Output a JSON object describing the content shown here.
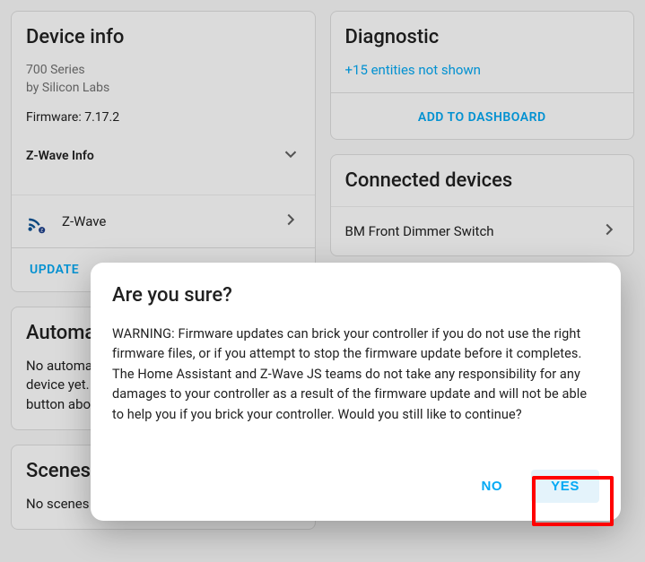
{
  "deviceInfo": {
    "title": "Device info",
    "series": "700 Series",
    "manufacturer": "by Silicon Labs",
    "firmwareLabel": "Firmware: 7.17.2",
    "zwaveInfoLabel": "Z-Wave Info",
    "zwaveLinkLabel": "Z-Wave",
    "updateLabel": "UPDATE"
  },
  "automations": {
    "title": "Automations",
    "body": "No automations have been added using this device yet. You can add one using the Create button above."
  },
  "scenes": {
    "title": "Scenes",
    "body": "No scenes have been added using this device"
  },
  "diagnostic": {
    "title": "Diagnostic",
    "entitiesNotShown": "+15 entities not shown",
    "addToDashboard": "ADD TO DASHBOARD"
  },
  "connected": {
    "title": "Connected devices",
    "items": [
      "BM Front Dimmer Switch"
    ]
  },
  "dialog": {
    "title": "Are you sure?",
    "message": "WARNING: Firmware updates can brick your controller if you do not use the right firmware files, or if you attempt to stop the firmware update before it completes. The Home Assistant and Z-Wave JS teams do not take any responsibility for any damages to your controller as a result of the firmware update and will not be able to help you if you brick your controller. Would you still like to continue?",
    "no": "NO",
    "yes": "YES"
  }
}
